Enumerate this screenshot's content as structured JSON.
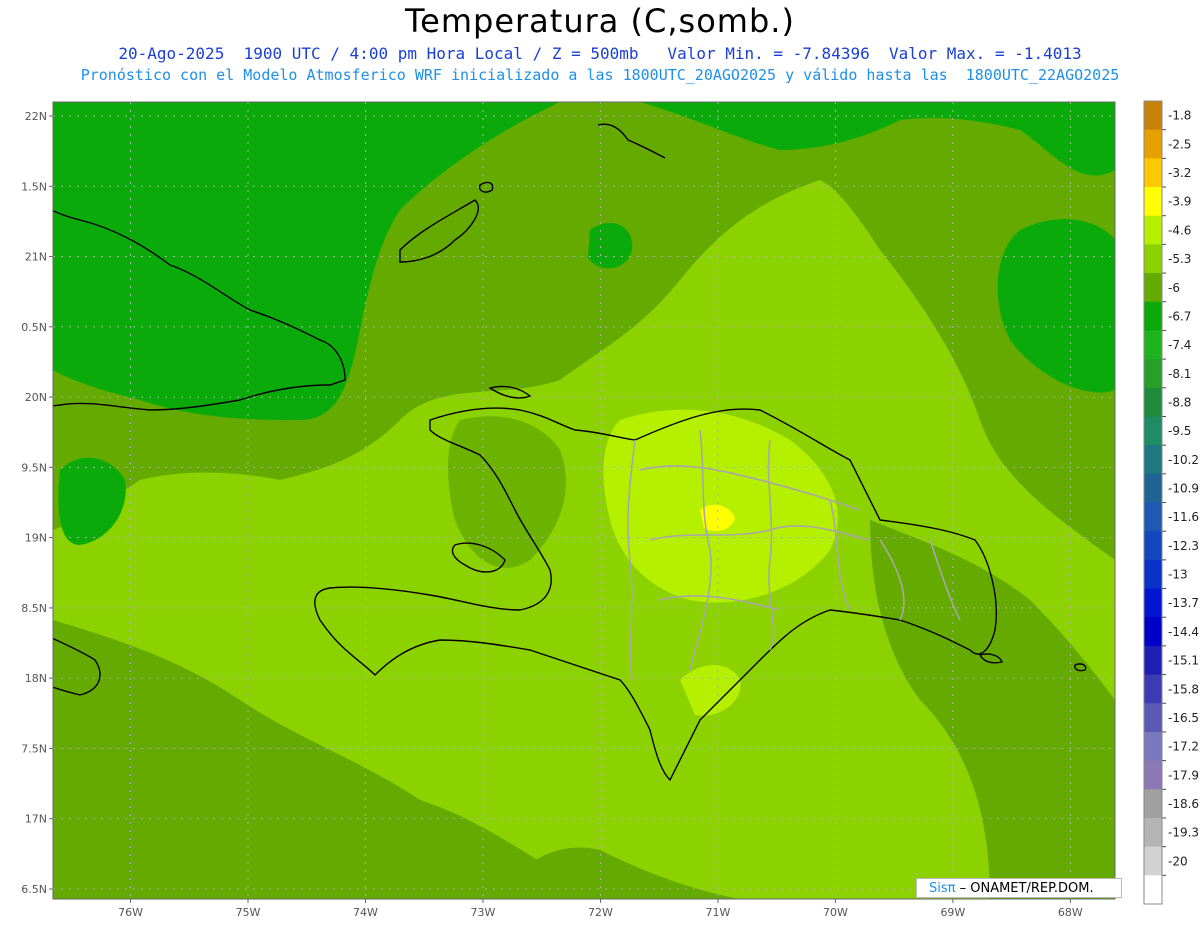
{
  "header": {
    "title": "Temperatura (C,somb.)",
    "line1": "20-Ago-2025  1900 UTC / 4:00 pm Hora Local / Z = 500mb   Valor Min. = -7.84396  Valor Max. = -1.4013",
    "line2": "Pronóstico con el Modelo Atmosferico WRF inicializado a las 1800UTC_20AGO2025 y válido hasta las  1800UTC_22AGO2025"
  },
  "map": {
    "lon_range": [
      -76.66,
      -67.62
    ],
    "lat_range": [
      6.4,
      22.1
    ],
    "lat_ticks": [
      {
        "value": 22,
        "label": "22N"
      },
      {
        "value": 21.5,
        "label": "1.5N"
      },
      {
        "value": 21,
        "label": "21N"
      },
      {
        "value": 20.5,
        "label": "0.5N"
      },
      {
        "value": 20,
        "label": "20N"
      },
      {
        "value": 19.5,
        "label": "9.5N"
      },
      {
        "value": 19,
        "label": "19N"
      },
      {
        "value": 18.5,
        "label": "8.5N"
      },
      {
        "value": 18,
        "label": "18N"
      },
      {
        "value": 17.5,
        "label": "7.5N"
      },
      {
        "value": 17,
        "label": "17N"
      },
      {
        "value": 16.5,
        "label": "6.5N"
      }
    ],
    "lon_ticks": [
      {
        "value": -76,
        "label": "76W"
      },
      {
        "value": -75,
        "label": "75W"
      },
      {
        "value": -74,
        "label": "74W"
      },
      {
        "value": -73,
        "label": "73W"
      },
      {
        "value": -72,
        "label": "72W"
      },
      {
        "value": -71,
        "label": "71W"
      },
      {
        "value": -70,
        "label": "70W"
      },
      {
        "value": -69,
        "label": "69W"
      },
      {
        "value": -68,
        "label": "68W"
      }
    ],
    "grid": true
  },
  "colorbar": {
    "levels": [
      {
        "label": "-1.8",
        "color": "#c8820a"
      },
      {
        "label": "-2.5",
        "color": "#e6a000"
      },
      {
        "label": "-3.2",
        "color": "#ffc800"
      },
      {
        "label": "-3.9",
        "color": "#ffff00"
      },
      {
        "label": "-4.6",
        "color": "#b4f000"
      },
      {
        "label": "-5.3",
        "color": "#8cd200"
      },
      {
        "label": "-6",
        "color": "#64aa00"
      },
      {
        "label": "-6.7",
        "color": "#0aaa0a"
      },
      {
        "label": "-7.4",
        "color": "#1eb41e"
      },
      {
        "label": "-8.1",
        "color": "#28a028"
      },
      {
        "label": "-8.8",
        "color": "#1e8c3c"
      },
      {
        "label": "-9.5",
        "color": "#1e8c64"
      },
      {
        "label": "-10.2",
        "color": "#1e7882"
      },
      {
        "label": "-10.9",
        "color": "#1e6496"
      },
      {
        "label": "-11.6",
        "color": "#1e5ab4"
      },
      {
        "label": "-12.3",
        "color": "#1446be"
      },
      {
        "label": "-13",
        "color": "#0a32c8"
      },
      {
        "label": "-13.7",
        "color": "#0014d2"
      },
      {
        "label": "-14.4",
        "color": "#0000c8"
      },
      {
        "label": "-15.1",
        "color": "#1e1eb4"
      },
      {
        "label": "-15.8",
        "color": "#3c3cb4"
      },
      {
        "label": "-16.5",
        "color": "#5a5ab4"
      },
      {
        "label": "-17.2",
        "color": "#7878be"
      },
      {
        "label": "-17.9",
        "color": "#8c78b4"
      },
      {
        "label": "-18.6",
        "color": "#a0a0a0"
      },
      {
        "label": "-19.3",
        "color": "#b4b4b4"
      },
      {
        "label": "-20",
        "color": "#d2d2d2"
      },
      {
        "label": "",
        "color": "#ffffff"
      }
    ]
  },
  "credit": {
    "sis": "Sisπ",
    "text": " –  ONAMET/REP.DOM."
  }
}
